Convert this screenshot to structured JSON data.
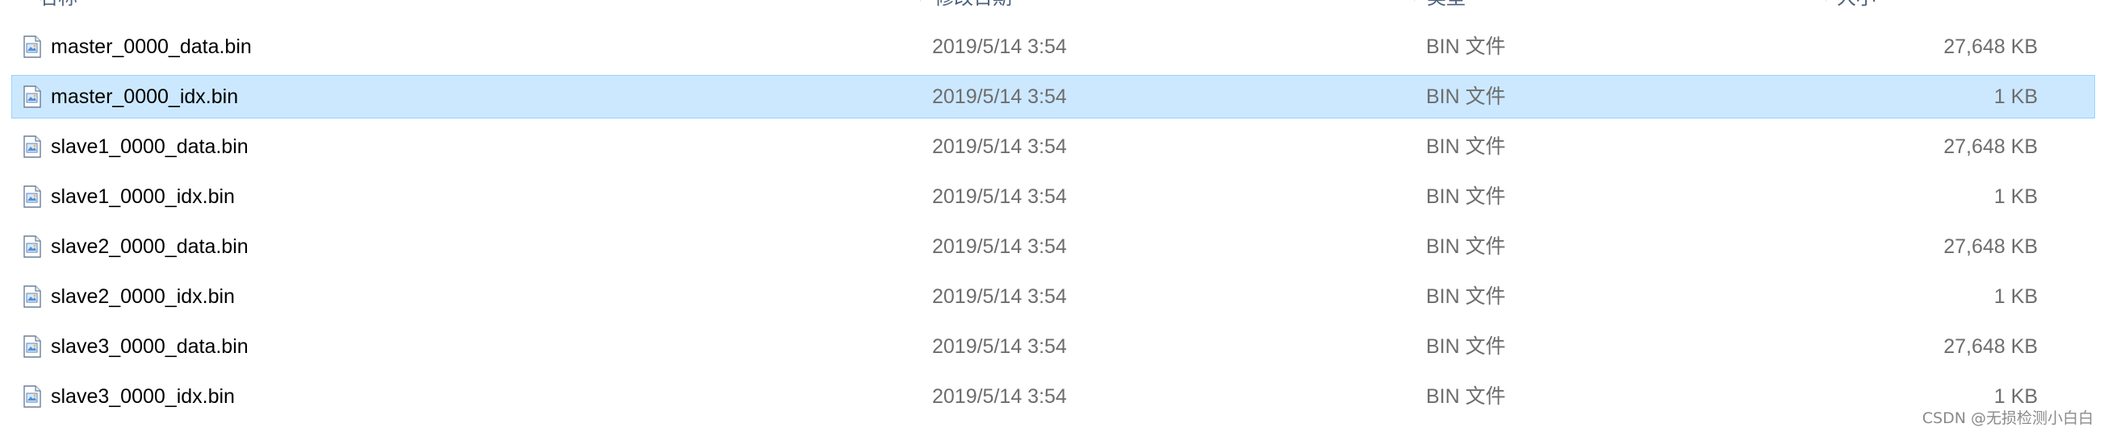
{
  "columns": {
    "name": "名称",
    "date": "修改日期",
    "type": "类型",
    "size": "大小"
  },
  "files": [
    {
      "name": "master_0000_data.bin",
      "date": "2019/5/14 3:54",
      "type": "BIN 文件",
      "size": "27,648 KB",
      "selected": false
    },
    {
      "name": "master_0000_idx.bin",
      "date": "2019/5/14 3:54",
      "type": "BIN 文件",
      "size": "1 KB",
      "selected": true
    },
    {
      "name": "slave1_0000_data.bin",
      "date": "2019/5/14 3:54",
      "type": "BIN 文件",
      "size": "27,648 KB",
      "selected": false
    },
    {
      "name": "slave1_0000_idx.bin",
      "date": "2019/5/14 3:54",
      "type": "BIN 文件",
      "size": "1 KB",
      "selected": false
    },
    {
      "name": "slave2_0000_data.bin",
      "date": "2019/5/14 3:54",
      "type": "BIN 文件",
      "size": "27,648 KB",
      "selected": false
    },
    {
      "name": "slave2_0000_idx.bin",
      "date": "2019/5/14 3:54",
      "type": "BIN 文件",
      "size": "1 KB",
      "selected": false
    },
    {
      "name": "slave3_0000_data.bin",
      "date": "2019/5/14 3:54",
      "type": "BIN 文件",
      "size": "27,648 KB",
      "selected": false
    },
    {
      "name": "slave3_0000_idx.bin",
      "date": "2019/5/14 3:54",
      "type": "BIN 文件",
      "size": "1 KB",
      "selected": false
    }
  ],
  "file_icon": "generic-file-icon",
  "colors": {
    "selection_bg": "#cce8ff",
    "selection_border": "#99d1ff",
    "secondary_text": "#6d6d6d"
  },
  "watermark": "CSDN @无损检测小白白"
}
